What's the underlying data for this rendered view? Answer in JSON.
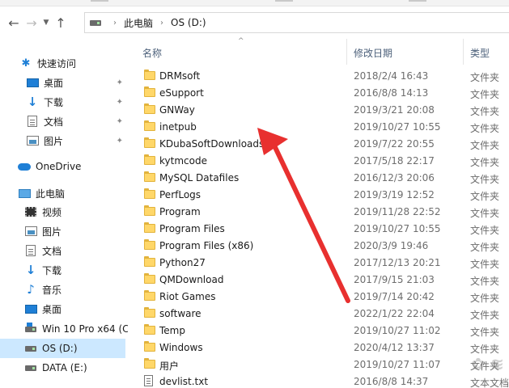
{
  "address": {
    "crumbs": [
      "此电脑",
      "OS (D:)"
    ]
  },
  "columns": {
    "name": "名称",
    "date": "修改日期",
    "type": "类型"
  },
  "sidebar": {
    "items": [
      {
        "label": "快速访问",
        "icon": "star-icon"
      },
      {
        "label": "桌面",
        "icon": "desktop-icon",
        "pinned": true
      },
      {
        "label": "下载",
        "icon": "download-icon",
        "pinned": true
      },
      {
        "label": "文档",
        "icon": "document-icon",
        "pinned": true
      },
      {
        "label": "图片",
        "icon": "picture-icon",
        "pinned": true
      },
      {
        "label": "OneDrive",
        "icon": "cloud-icon"
      },
      {
        "label": "此电脑",
        "icon": "computer-icon"
      },
      {
        "label": "视频",
        "icon": "video-icon"
      },
      {
        "label": "图片",
        "icon": "picture-icon"
      },
      {
        "label": "文档",
        "icon": "document-icon"
      },
      {
        "label": "下载",
        "icon": "download-icon"
      },
      {
        "label": "音乐",
        "icon": "music-icon"
      },
      {
        "label": "桌面",
        "icon": "desktop-icon"
      },
      {
        "label": "Win 10 Pro x64 (C",
        "icon": "windows-drive-icon"
      },
      {
        "label": "OS (D:)",
        "icon": "drive-icon",
        "selected": true
      },
      {
        "label": "DATA (E:)",
        "icon": "drive-icon"
      }
    ]
  },
  "files": [
    {
      "name": "DRMsoft",
      "date": "2018/2/4 16:43",
      "type": "文件夹",
      "kind": "folder"
    },
    {
      "name": "eSupport",
      "date": "2016/8/8 14:13",
      "type": "文件夹",
      "kind": "folder"
    },
    {
      "name": "GNWay",
      "date": "2019/3/21 20:08",
      "type": "文件夹",
      "kind": "folder"
    },
    {
      "name": "inetpub",
      "date": "2019/10/27 10:55",
      "type": "文件夹",
      "kind": "folder"
    },
    {
      "name": "KDubaSoftDownloads",
      "date": "2019/7/22 20:55",
      "type": "文件夹",
      "kind": "folder"
    },
    {
      "name": "kytmcode",
      "date": "2017/5/18 22:17",
      "type": "文件夹",
      "kind": "folder"
    },
    {
      "name": "MySQL Datafiles",
      "date": "2016/12/3 20:06",
      "type": "文件夹",
      "kind": "folder"
    },
    {
      "name": "PerfLogs",
      "date": "2019/3/19 12:52",
      "type": "文件夹",
      "kind": "folder"
    },
    {
      "name": "Program",
      "date": "2019/11/28 22:52",
      "type": "文件夹",
      "kind": "folder"
    },
    {
      "name": "Program Files",
      "date": "2019/10/27 10:55",
      "type": "文件夹",
      "kind": "folder"
    },
    {
      "name": "Program Files (x86)",
      "date": "2020/3/9 19:46",
      "type": "文件夹",
      "kind": "folder"
    },
    {
      "name": "Python27",
      "date": "2017/12/13 20:21",
      "type": "文件夹",
      "kind": "folder"
    },
    {
      "name": "QMDownload",
      "date": "2017/9/15 21:03",
      "type": "文件夹",
      "kind": "folder"
    },
    {
      "name": "Riot Games",
      "date": "2019/7/14 20:42",
      "type": "文件夹",
      "kind": "folder"
    },
    {
      "name": "software",
      "date": "2022/1/22 22:04",
      "type": "文件夹",
      "kind": "folder"
    },
    {
      "name": "Temp",
      "date": "2019/10/27 11:02",
      "type": "文件夹",
      "kind": "folder"
    },
    {
      "name": "Windows",
      "date": "2020/4/12 13:37",
      "type": "文件夹",
      "kind": "folder"
    },
    {
      "name": "用户",
      "date": "2019/10/27 11:07",
      "type": "文件夹",
      "kind": "folder"
    },
    {
      "name": "devlist.txt",
      "date": "2016/8/8 14:37",
      "type": "文本文档",
      "kind": "text"
    }
  ],
  "colors": {
    "selection": "#cce8ff",
    "folder": "#ffd769",
    "arrow": "#e8302f",
    "header_text": "#4c607a"
  }
}
